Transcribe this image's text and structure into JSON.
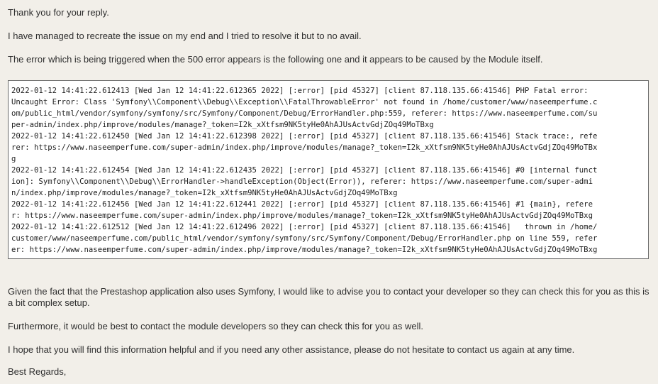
{
  "message": {
    "greeting": "Thank you for your reply.",
    "intro": "I have managed to recreate the issue on my end and I tried to resolve it but to no avail.",
    "error_intro": "The error which is being triggered when the 500 error appears is the following one and it appears to be caused by the Module itself.",
    "log_lines": [
      "2022-01-12 14:41:22.612413 [Wed Jan 12 14:41:22.612365 2022] [:error] [pid 45327] [client 87.118.135.66:41546] PHP Fatal error:",
      "Uncaught Error: Class 'Symfony\\\\Component\\\\Debug\\\\Exception\\\\FatalThrowableError' not found in /home/customer/www/naseemperfume.c",
      "om/public_html/vendor/symfony/symfony/src/Symfony/Component/Debug/ErrorHandler.php:559, referer: https://www.naseemperfume.com/su",
      "per-admin/index.php/improve/modules/manage?_token=I2k_xXtfsm9NK5tyHe0AhAJUsActvGdjZOq49MoTBxg",
      "2022-01-12 14:41:22.612450 [Wed Jan 12 14:41:22.612398 2022] [:error] [pid 45327] [client 87.118.135.66:41546] Stack trace:, refe",
      "rer: https://www.naseemperfume.com/super-admin/index.php/improve/modules/manage?_token=I2k_xXtfsm9NK5tyHe0AhAJUsActvGdjZOq49MoTBx",
      "g",
      "2022-01-12 14:41:22.612454 [Wed Jan 12 14:41:22.612435 2022] [:error] [pid 45327] [client 87.118.135.66:41546] #0 [internal funct",
      "ion]: Symfony\\\\Component\\\\Debug\\\\ErrorHandler->handleException(Object(Error)), referer: https://www.naseemperfume.com/super-admi",
      "n/index.php/improve/modules/manage?_token=I2k_xXtfsm9NK5tyHe0AhAJUsActvGdjZOq49MoTBxg",
      "2022-01-12 14:41:22.612456 [Wed Jan 12 14:41:22.612441 2022] [:error] [pid 45327] [client 87.118.135.66:41546] #1 {main}, refere",
      "r: https://www.naseemperfume.com/super-admin/index.php/improve/modules/manage?_token=I2k_xXtfsm9NK5tyHe0AhAJUsActvGdjZOq49MoTBxg",
      "2022-01-12 14:41:22.612512 [Wed Jan 12 14:41:22.612496 2022] [:error] [pid 45327] [client 87.118.135.66:41546]   thrown in /home/",
      "customer/www/naseemperfume.com/public_html/vendor/symfony/symfony/src/Symfony/Component/Debug/ErrorHandler.php on line 559, refer",
      "er: https://www.naseemperfume.com/super-admin/index.php/improve/modules/manage?_token=I2k_xXtfsm9NK5tyHe0AhAJUsActvGdjZOq49MoTBxg"
    ],
    "advice": "Given the fact that the Prestashop application also uses Symfony, I would like to advise you to contact your developer so they can check this for you as this is a bit complex setup.",
    "module_devs": "Furthermore, it would be best to contact the module developers so they can check this for you as well.",
    "closing": "I hope that you will find this information helpful and if you need any other assistance, please do not hesitate to contact us again at any time.",
    "signoff": "Best Regards,"
  },
  "colors": {
    "background": "#f2efe9",
    "text": "#2f2f2f",
    "code_background": "#ffffff",
    "code_border": "#6a6a6a"
  }
}
